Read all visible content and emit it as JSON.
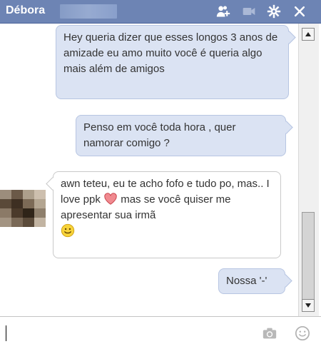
{
  "header": {
    "contact_name": "Débora",
    "icons": [
      "add-friends-icon",
      "video-call-icon",
      "settings-gear-icon",
      "close-icon"
    ]
  },
  "messages": [
    {
      "from": "me",
      "text": "Hey queria dizer que esses longos 3 anos de amizade eu amo muito você é queria algo mais além de amigos"
    },
    {
      "from": "me",
      "text": "Penso em você toda hora , quer namorar comigo ?"
    },
    {
      "from": "them",
      "text_part1": "awn teteu, eu te acho fofo e tudo po, mas.. I love ppk",
      "heart_icon": "heart-icon",
      "text_part2": "mas se você quiser me apresentar sua irmã",
      "smiley_icon": "smiley-icon"
    },
    {
      "from": "me",
      "text": "Nossa '-'"
    }
  ],
  "composer": {
    "value": "",
    "placeholder": "",
    "icons": [
      "camera-icon",
      "emoticon-icon"
    ]
  },
  "colors": {
    "header_bg": "#6d84b4",
    "my_bubble_bg": "#dbe3f3",
    "their_bubble_bg": "#ffffff",
    "heart": "#e8626a",
    "smiley": "#f2c21a"
  }
}
